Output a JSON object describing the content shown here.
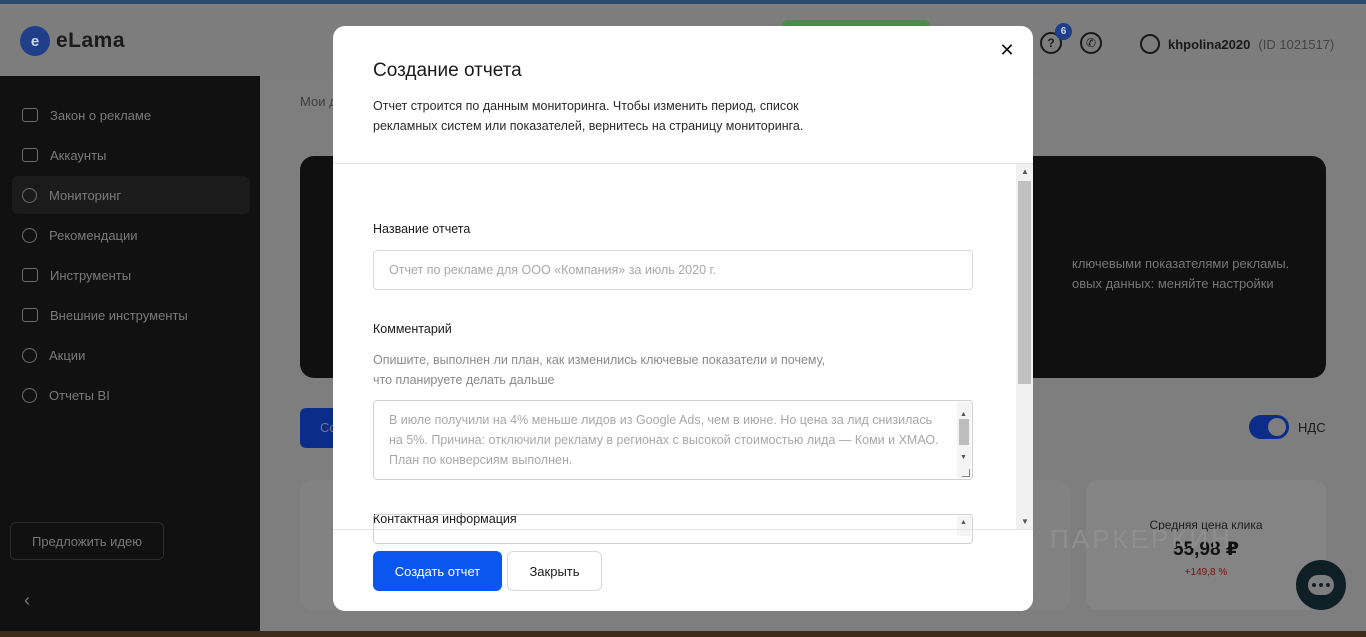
{
  "app": {
    "logo_mark": "e",
    "logo_text": "eLama",
    "help_badge": "6",
    "user_name": "khpolina2020",
    "user_id": "(ID 1021517)"
  },
  "sidebar": {
    "items": [
      {
        "label": "Закон о рекламе",
        "icon": "id-card-icon"
      },
      {
        "label": "Аккаунты",
        "icon": "book-icon"
      },
      {
        "label": "Мониторинг",
        "icon": "clock-icon",
        "active": true
      },
      {
        "label": "Рекомендации",
        "icon": "check-circle-icon"
      },
      {
        "label": "Инструменты",
        "icon": "magic-wand-icon"
      },
      {
        "label": "Внешние инструменты",
        "icon": "external-icon"
      },
      {
        "label": "Акции",
        "icon": "fire-icon"
      },
      {
        "label": "Отчеты BI",
        "icon": "globe-icon"
      }
    ],
    "idea_button": "Предложить идею",
    "collapse": "‹"
  },
  "main": {
    "breadcrumb": "Мои д",
    "promo_line1": "ключевыми показателями рекламы.",
    "promo_line2": "овых данных: меняйте настройки",
    "blue_button_fragment": "Со",
    "vat_label": "НДС",
    "kpi_label": "Средняя цена клика",
    "kpi_value": "55,98 ₽",
    "kpi_delta": "+149,8 %",
    "watermark": "ПАРКЕРКИН"
  },
  "modal": {
    "title": "Создание отчета",
    "description": "Отчет строится по данным мониторинга. Чтобы изменить период, список рекламных систем или показателей, вернитесь на страницу мониторинга.",
    "close_symbol": "✕",
    "report_name_label": "Название отчета",
    "report_name_placeholder": "Отчет по рекламе для ООО «Компания» за июль 2020 г.",
    "report_name_value": "",
    "comment_label": "Комментарий",
    "comment_hint": "Опишите, выполнен ли план, как изменились ключевые показатели и почему, что планируете делать дальше",
    "comment_placeholder": "В июле получили на 4% меньше лидов из Google Ads, чем в июне. Но цена за лид снизилась на 5%. Причина: отключили рекламу в регионах с высокой стоимостью лида — Коми и ХМАО. План по конверсиям выполнен.",
    "contact_label": "Контактная информация",
    "create_button": "Создать отчет",
    "close_button": "Закрыть"
  },
  "colors": {
    "primary": "#0a57f0",
    "overlay": "#7e7e7e",
    "sidebar": "#111111",
    "kpi_delta": "#c0392b"
  }
}
